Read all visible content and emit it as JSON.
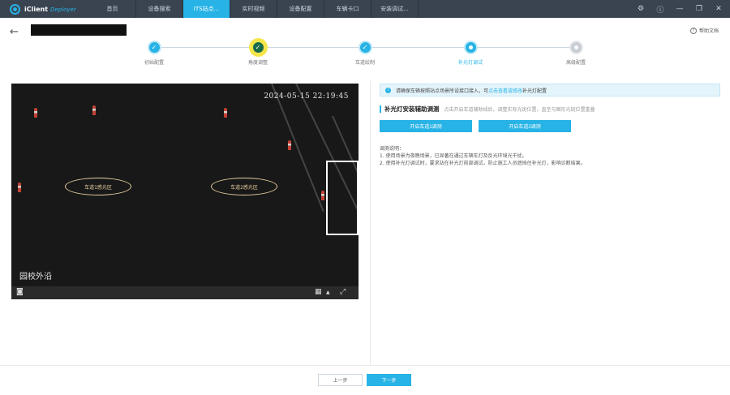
{
  "app": {
    "name": "iClient",
    "sub": "Deployer"
  },
  "nav": {
    "items": [
      {
        "label": "首页"
      },
      {
        "label": "设备搜索"
      },
      {
        "label": "ITS站点..."
      },
      {
        "label": "实时视频"
      },
      {
        "label": "设备配置"
      },
      {
        "label": "车辆卡口"
      },
      {
        "label": "安装调试..."
      }
    ]
  },
  "window": {
    "settings_icon": "gear-icon",
    "help_icon": "help-icon"
  },
  "header": {
    "title": "",
    "help_label": "帮助文档"
  },
  "steps": [
    {
      "label": "初始配置",
      "state": "done"
    },
    {
      "label": "角度调整",
      "state": "done"
    },
    {
      "label": "车道绘制",
      "state": "done"
    },
    {
      "label": "补光灯调试",
      "state": "current"
    },
    {
      "label": "高级配置",
      "state": "pending"
    }
  ],
  "video": {
    "timestamp": "2024-05-15 22:19:45",
    "camera_name": "园校外沿",
    "lane1_label": "车道1感光区",
    "lane2_label": "车道2感光区"
  },
  "panel": {
    "tip_text": "请确保车辆按照站点场景所设接口接入，可",
    "tip_link": "点击查看或修改",
    "tip_tail": "补光灯配置",
    "section_title": "补光灯安装辅助调测",
    "section_desc": "点击开启车道辅助线后，调整实际光斑位置，直至与图形光斑位置重叠",
    "btn_lane1": "开启车道1调测",
    "btn_lane2": "开启车道2调测",
    "notes_title": "调测说明：",
    "note1": "1. 使用场景为夜晚场景，已显著在通过车辆车灯及反光环境光干扰。",
    "note2": "2. 使用补光灯调试时，要求站在补光灯前部调试，防止施工人员遮挡住补光灯，影响诊断结果。"
  },
  "footer": {
    "prev_label": "上一步",
    "next_label": "下一步"
  }
}
